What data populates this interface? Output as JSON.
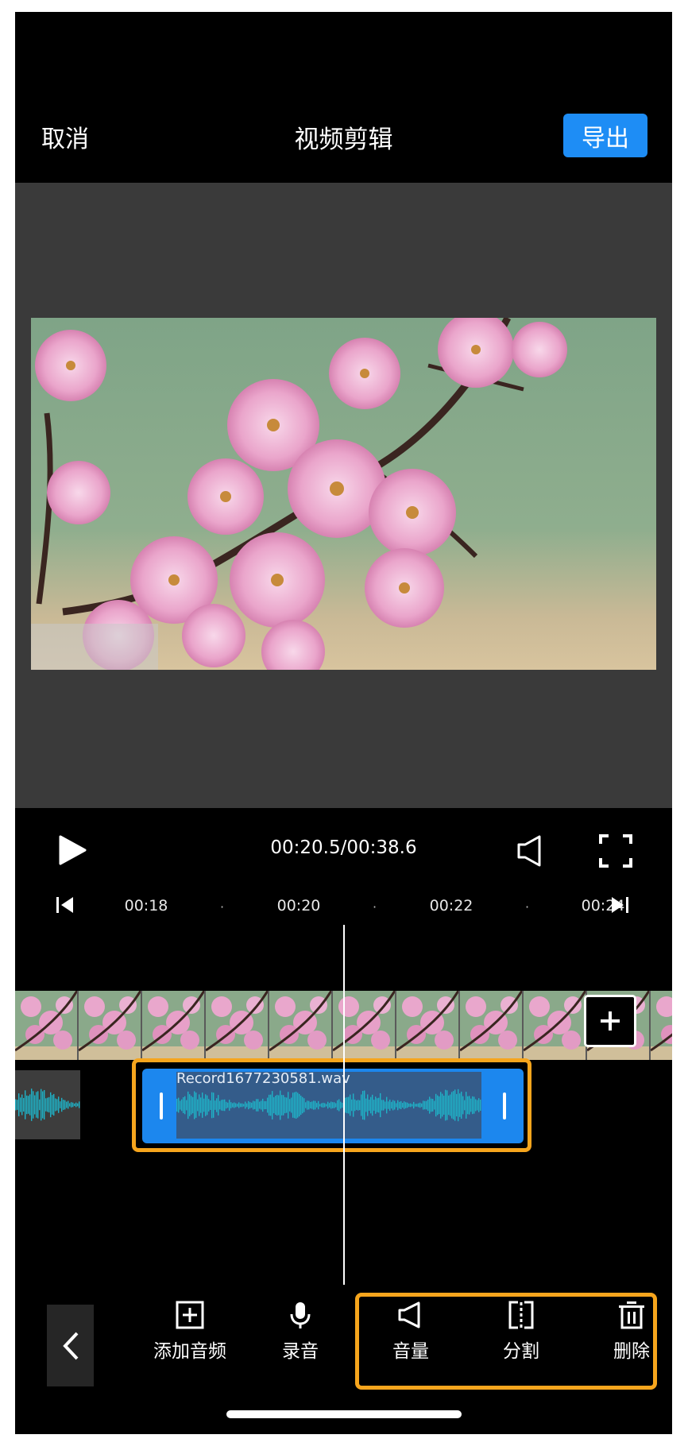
{
  "header": {
    "cancel_label": "取消",
    "title": "视频剪辑",
    "export_label": "导出"
  },
  "player": {
    "timecode": "00:20.5/00:38.6"
  },
  "ruler": {
    "ticks": [
      "00:18",
      "00:20",
      "00:22",
      "00:24"
    ]
  },
  "audio_clip": {
    "filename": "Record1677230581.wav"
  },
  "toolbar": {
    "add_audio": "添加音频",
    "record": "录音",
    "volume": "音量",
    "split": "分割",
    "delete": "删除"
  },
  "colors": {
    "accent_blue": "#1e8df5",
    "highlight_orange": "#f6a51d",
    "waveform_teal": "#1fb3c8"
  }
}
